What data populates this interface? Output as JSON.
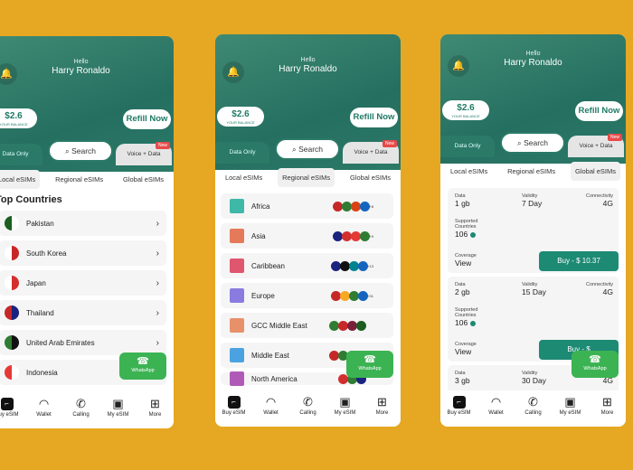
{
  "colors": {
    "background": "#E6A723",
    "brand": "#2b7a67",
    "button": "#1d8a74",
    "whatsapp": "#3cb353",
    "badge": "#e84a4a"
  },
  "header": {
    "greeting": "Hello",
    "user_name": "Harry Ronaldo",
    "balance": "$2.6",
    "balance_label": "YOUR BALANCE",
    "refill": "Refill Now",
    "bell_icon": "bell-icon"
  },
  "plan_tabs": {
    "data_only": "Data Only",
    "search": "Search",
    "voice_data": "Voice + Data",
    "new_badge": "New"
  },
  "esim_tabs": [
    "Local eSIMs",
    "Regional eSIMs",
    "Global eSIMs"
  ],
  "top_countries_title": "Top Countries",
  "countries": [
    {
      "name": "Pakistan",
      "colors": [
        "#1b5e20",
        "#fff"
      ]
    },
    {
      "name": "South Korea",
      "colors": [
        "#fff",
        "#c62828"
      ]
    },
    {
      "name": "Japan",
      "colors": [
        "#fff",
        "#d32f2f"
      ]
    },
    {
      "name": "Thailand",
      "colors": [
        "#c62828",
        "#1a237e"
      ]
    },
    {
      "name": "United Arab Emirates",
      "colors": [
        "#2e7d32",
        "#111"
      ]
    },
    {
      "name": "Indonesia",
      "colors": [
        "#e53935",
        "#fff"
      ]
    }
  ],
  "regions": [
    {
      "name": "Africa",
      "color": "#3fb8a8",
      "more": "+8",
      "flags": [
        "#c62828",
        "#2e7d32",
        "#d84315",
        "#1565c0"
      ]
    },
    {
      "name": "Asia",
      "color": "#e57a5a",
      "more": "+9",
      "flags": [
        "#1a237e",
        "#d32f2f",
        "#e53935",
        "#2e7d32"
      ]
    },
    {
      "name": "Caribbean",
      "color": "#e0566e",
      "more": "+13",
      "flags": [
        "#1a237e",
        "#111",
        "#00838f",
        "#1565c0"
      ]
    },
    {
      "name": "Europe",
      "color": "#8a7be0",
      "more": "+31",
      "flags": [
        "#c62828",
        "#f9a825",
        "#2e7d32",
        "#1565c0"
      ]
    },
    {
      "name": "GCC Middle East",
      "color": "#e8906a",
      "more": "",
      "flags": [
        "#2e7d32",
        "#c62828",
        "#7b1f3a",
        "#1b5e20"
      ]
    },
    {
      "name": "Middle East",
      "color": "#4aa3e0",
      "more": "",
      "flags": [
        "#c62828",
        "#2e7d32",
        "#111",
        "#1b5e20"
      ]
    },
    {
      "name": "North America",
      "color": "#b05ab8",
      "more": "",
      "flags": [
        "#d32f2f",
        "#2e7d32",
        "#1a237e"
      ]
    }
  ],
  "plans": [
    {
      "data_label": "Data",
      "data": "1 gb",
      "validity_label": "Validity",
      "validity": "7 Day",
      "conn_label": "Connectivity",
      "conn": "4G",
      "countries_label": "Supported Countries",
      "countries": "106",
      "coverage_label": "Coverage",
      "coverage": "View",
      "buy": "Buy - $ 10.37"
    },
    {
      "data_label": "Data",
      "data": "2 gb",
      "validity_label": "Validity",
      "validity": "15 Day",
      "conn_label": "Connectivity",
      "conn": "4G",
      "countries_label": "Supported Countries",
      "countries": "106",
      "coverage_label": "Coverage",
      "coverage": "View",
      "buy": "Buy - $"
    },
    {
      "data_label": "Data",
      "data": "3 gb",
      "validity_label": "Validity",
      "validity": "30 Day",
      "conn_label": "Connectivity",
      "conn": "4G"
    }
  ],
  "nav": [
    {
      "label": "Buy eSIM",
      "icon": "sim-icon"
    },
    {
      "label": "Wallet",
      "icon": "wallet-icon"
    },
    {
      "label": "Calling",
      "icon": "phone-icon"
    },
    {
      "label": "My eSIM",
      "icon": "my-esim-icon"
    },
    {
      "label": "More",
      "icon": "grid-plus-icon"
    }
  ],
  "whatsapp": "WhatsApp"
}
